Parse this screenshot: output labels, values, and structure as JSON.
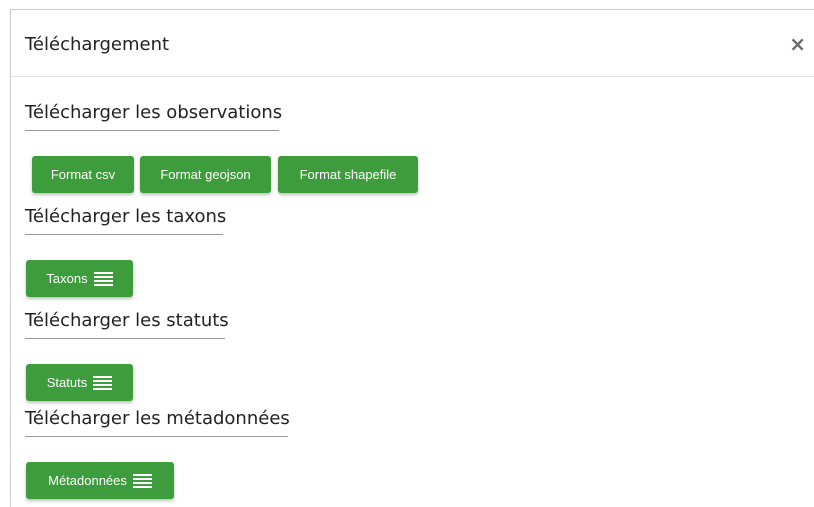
{
  "modal": {
    "title": "Téléchargement",
    "close_label": "×"
  },
  "sections": {
    "observations": {
      "heading": "Télécharger les observations",
      "buttons": [
        "Format csv",
        "Format geojson",
        "Format shapefile"
      ]
    },
    "taxons": {
      "heading": "Télécharger les taxons",
      "button": "Taxons",
      "icon": "list-icon"
    },
    "statuts": {
      "heading": "Télécharger les statuts",
      "button": "Statuts",
      "icon": "list-icon"
    },
    "metadonnees": {
      "heading": "Télécharger les métadonnées",
      "button": "Métadonnées",
      "icon": "list-icon"
    }
  },
  "colors": {
    "button_bg": "#3d9c3b",
    "button_text": "#ffffff"
  }
}
